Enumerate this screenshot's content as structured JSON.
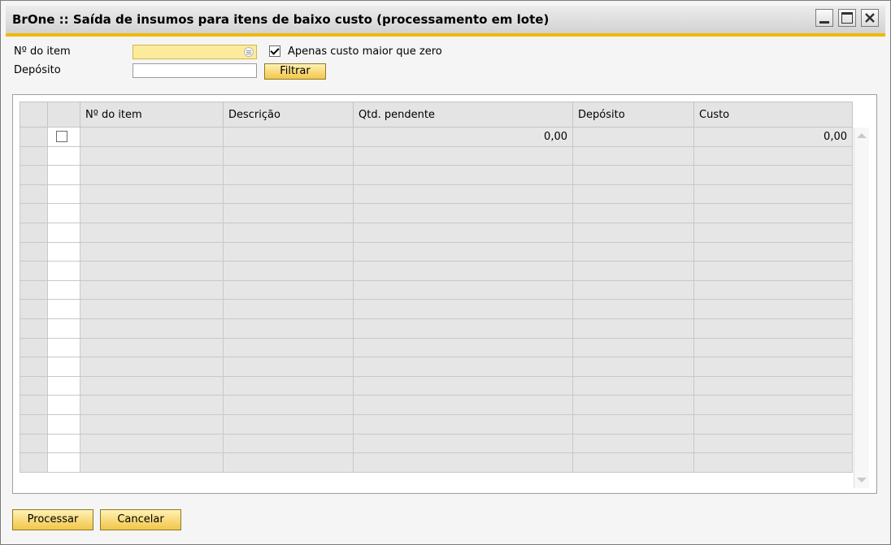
{
  "window": {
    "title": "BrOne :: Saída de insumos para itens de baixo custo (processamento em lote)"
  },
  "filters": {
    "item_label": "Nº do item",
    "item_value": "",
    "deposit_label": "Depósito",
    "deposit_value": "",
    "only_cost_label": "Apenas custo maior que zero",
    "only_cost_checked": true,
    "filter_button": "Filtrar"
  },
  "grid": {
    "columns": [
      "Nº do item",
      "Descrição",
      "Qtd. pendente",
      "Depósito",
      "Custo"
    ],
    "rows": [
      {
        "checked": false,
        "item": "",
        "description": "",
        "qty_pending": "0,00",
        "deposit": "",
        "cost": "0,00"
      }
    ]
  },
  "footer": {
    "process_button": "Processar",
    "cancel_button": "Cancelar"
  },
  "colors": {
    "accent": "#f2b800",
    "button": "#f2c649",
    "highlight_field": "#fdeb9c"
  }
}
